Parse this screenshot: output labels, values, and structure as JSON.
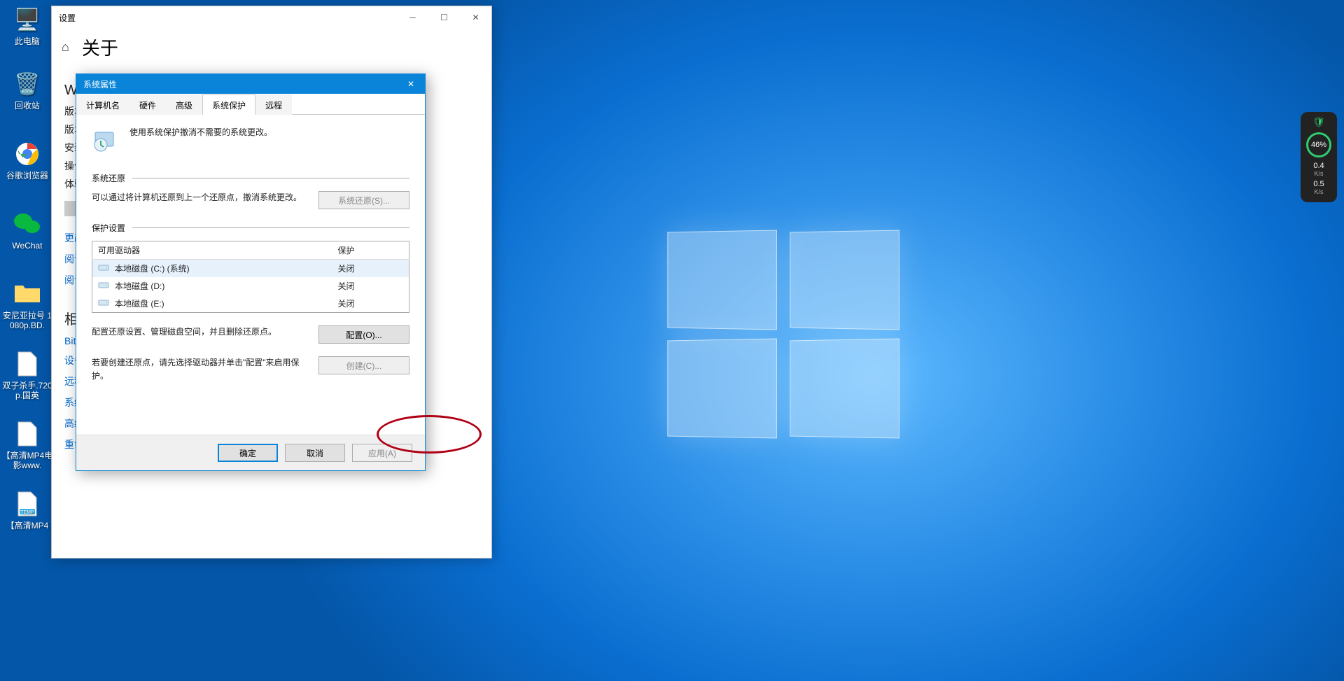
{
  "desktop": {
    "icons": [
      {
        "label": "此电脑",
        "glyph": "🖥️"
      },
      {
        "label": "回收站",
        "glyph": "🗑️"
      },
      {
        "label": "谷歌浏览器",
        "glyph": "🌐"
      },
      {
        "label": "WeChat",
        "glyph": "💬"
      },
      {
        "label": "安尼亚拉号 1080p.BD.",
        "glyph": "📁"
      },
      {
        "label": "双子杀手.720p.国英",
        "glyph": "📄"
      },
      {
        "label": "【高清MP4电影www.",
        "glyph": "📄"
      },
      {
        "label": "【高清MP4",
        "glyph": "📄"
      }
    ]
  },
  "settings": {
    "window_title": "设置",
    "header": "关于",
    "win_header_text": "Wi",
    "body_lines": {
      "l1": "版本",
      "l2": "版本",
      "l3": "安装",
      "l4": "操作",
      "l5": "体验"
    },
    "copy_label": " ",
    "links": {
      "l_change": "更改",
      "l_read1": "阅读",
      "l_read2": "阅读"
    },
    "section_related": "相",
    "link_bitlocker": "BitLo",
    "link_device": "设备",
    "link_remote": "远程",
    "link_system": "系统",
    "link_advanced": "高级系统设置",
    "link_rename": "重命名这台电脑"
  },
  "sysprop": {
    "title": "系统属性",
    "tabs": {
      "computer_name": "计算机名",
      "hardware": "硬件",
      "advanced": "高级",
      "system_protection": "系统保护",
      "remote": "远程"
    },
    "intro_text": "使用系统保护撤消不需要的系统更改。",
    "group_restore": "系统还原",
    "restore_desc": "可以通过将计算机还原到上一个还原点，撤消系统更改。",
    "btn_restore": "系统还原(S)...",
    "group_protect": "保护设置",
    "table_headers": {
      "drive": "可用驱动器",
      "protection": "保护"
    },
    "drives": [
      {
        "name": "本地磁盘 (C:) (系统)",
        "status": "关闭",
        "selected": true
      },
      {
        "name": "本地磁盘 (D:)",
        "status": "关闭",
        "selected": false
      },
      {
        "name": "本地磁盘 (E:)",
        "status": "关闭",
        "selected": false
      }
    ],
    "configure_desc": "配置还原设置、管理磁盘空间，并且删除还原点。",
    "btn_configure": "配置(O)...",
    "create_desc": "若要创建还原点，请先选择驱动器并单击\"配置\"来启用保护。",
    "btn_create": "创建(C)...",
    "footer": {
      "ok": "确定",
      "cancel": "取消",
      "apply": "应用(A)"
    }
  },
  "widget": {
    "pct": "46%",
    "net_up": "0.4",
    "net_up_unit": "K/s",
    "net_down": "0.5",
    "net_down_unit": "K/s"
  }
}
